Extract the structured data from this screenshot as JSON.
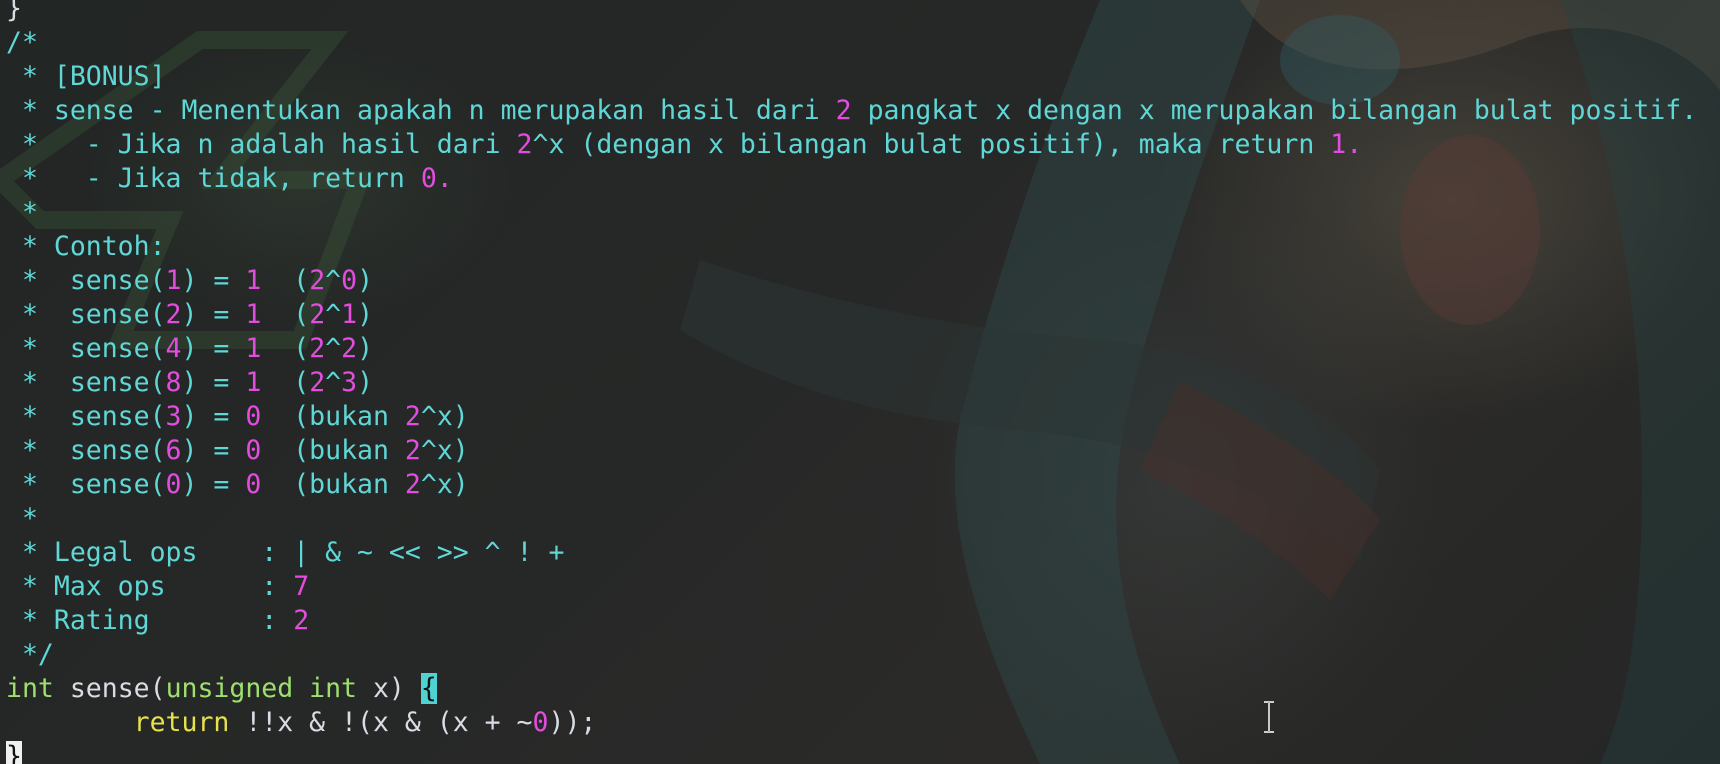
{
  "editor": {
    "lines": [
      [
        {
          "t": "}",
          "c": "plain"
        }
      ],
      [
        {
          "t": "/*",
          "c": "cmt"
        }
      ],
      [
        {
          "t": " * [BONUS]",
          "c": "cmt"
        }
      ],
      [
        {
          "t": " * sense - Menentukan apakah n merupakan hasil dari ",
          "c": "cmt"
        },
        {
          "t": "2",
          "c": "num"
        },
        {
          "t": " pangkat x dengan x merupakan bilangan bulat positif.",
          "c": "cmt"
        }
      ],
      [
        {
          "t": " *   - Jika n adalah hasil dari ",
          "c": "cmt"
        },
        {
          "t": "2",
          "c": "num"
        },
        {
          "t": "^x (dengan x bilangan bulat positif), maka return ",
          "c": "cmt"
        },
        {
          "t": "1.",
          "c": "num"
        }
      ],
      [
        {
          "t": " *   - Jika tidak, return ",
          "c": "cmt"
        },
        {
          "t": "0.",
          "c": "num"
        }
      ],
      [
        {
          "t": " *",
          "c": "cmt"
        }
      ],
      [
        {
          "t": " * Contoh:",
          "c": "cmt"
        }
      ],
      [
        {
          "t": " *  sense(",
          "c": "cmt"
        },
        {
          "t": "1",
          "c": "num"
        },
        {
          "t": ") = ",
          "c": "cmt"
        },
        {
          "t": "1",
          "c": "num"
        },
        {
          "t": "  (",
          "c": "cmt"
        },
        {
          "t": "2",
          "c": "num"
        },
        {
          "t": "^",
          "c": "cmt"
        },
        {
          "t": "0",
          "c": "num"
        },
        {
          "t": ")",
          "c": "cmt"
        }
      ],
      [
        {
          "t": " *  sense(",
          "c": "cmt"
        },
        {
          "t": "2",
          "c": "num"
        },
        {
          "t": ") = ",
          "c": "cmt"
        },
        {
          "t": "1",
          "c": "num"
        },
        {
          "t": "  (",
          "c": "cmt"
        },
        {
          "t": "2",
          "c": "num"
        },
        {
          "t": "^",
          "c": "cmt"
        },
        {
          "t": "1",
          "c": "num"
        },
        {
          "t": ")",
          "c": "cmt"
        }
      ],
      [
        {
          "t": " *  sense(",
          "c": "cmt"
        },
        {
          "t": "4",
          "c": "num"
        },
        {
          "t": ") = ",
          "c": "cmt"
        },
        {
          "t": "1",
          "c": "num"
        },
        {
          "t": "  (",
          "c": "cmt"
        },
        {
          "t": "2",
          "c": "num"
        },
        {
          "t": "^",
          "c": "cmt"
        },
        {
          "t": "2",
          "c": "num"
        },
        {
          "t": ")",
          "c": "cmt"
        }
      ],
      [
        {
          "t": " *  sense(",
          "c": "cmt"
        },
        {
          "t": "8",
          "c": "num"
        },
        {
          "t": ") = ",
          "c": "cmt"
        },
        {
          "t": "1",
          "c": "num"
        },
        {
          "t": "  (",
          "c": "cmt"
        },
        {
          "t": "2",
          "c": "num"
        },
        {
          "t": "^",
          "c": "cmt"
        },
        {
          "t": "3",
          "c": "num"
        },
        {
          "t": ")",
          "c": "cmt"
        }
      ],
      [
        {
          "t": " *  sense(",
          "c": "cmt"
        },
        {
          "t": "3",
          "c": "num"
        },
        {
          "t": ") = ",
          "c": "cmt"
        },
        {
          "t": "0",
          "c": "num"
        },
        {
          "t": "  (bukan ",
          "c": "cmt"
        },
        {
          "t": "2",
          "c": "num"
        },
        {
          "t": "^x)",
          "c": "cmt"
        }
      ],
      [
        {
          "t": " *  sense(",
          "c": "cmt"
        },
        {
          "t": "6",
          "c": "num"
        },
        {
          "t": ") = ",
          "c": "cmt"
        },
        {
          "t": "0",
          "c": "num"
        },
        {
          "t": "  (bukan ",
          "c": "cmt"
        },
        {
          "t": "2",
          "c": "num"
        },
        {
          "t": "^x)",
          "c": "cmt"
        }
      ],
      [
        {
          "t": " *  sense(",
          "c": "cmt"
        },
        {
          "t": "0",
          "c": "num"
        },
        {
          "t": ") = ",
          "c": "cmt"
        },
        {
          "t": "0",
          "c": "num"
        },
        {
          "t": "  (bukan ",
          "c": "cmt"
        },
        {
          "t": "2",
          "c": "num"
        },
        {
          "t": "^x)",
          "c": "cmt"
        }
      ],
      [
        {
          "t": " *",
          "c": "cmt"
        }
      ],
      [
        {
          "t": " * Legal ops    : | & ~ << >> ^ ! +",
          "c": "cmt"
        }
      ],
      [
        {
          "t": " * Max ops      : ",
          "c": "cmt"
        },
        {
          "t": "7",
          "c": "num"
        }
      ],
      [
        {
          "t": " * Rating       : ",
          "c": "cmt"
        },
        {
          "t": "2",
          "c": "num"
        }
      ],
      [
        {
          "t": " */",
          "c": "cmt"
        }
      ],
      [
        {
          "t": "int",
          "c": "tyg"
        },
        {
          "t": " sense(",
          "c": "plain"
        },
        {
          "t": "unsigned int",
          "c": "tyg"
        },
        {
          "t": " x) ",
          "c": "plain"
        },
        {
          "t": "{",
          "c": "brace-hl"
        }
      ],
      [
        {
          "t": "        ",
          "c": "plain"
        },
        {
          "t": "return",
          "c": "kw"
        },
        {
          "t": " !!x & !(x & (x + ~",
          "c": "plain"
        },
        {
          "t": "0",
          "c": "num"
        },
        {
          "t": "));",
          "c": "plain"
        }
      ],
      [
        {
          "t": "}",
          "c": "cursor-block"
        }
      ]
    ]
  },
  "colors": {
    "comment": "#5fd7d7",
    "number": "#e24de0",
    "keyword": "#e7e24a",
    "type": "#9ee06e",
    "text": "#d9dde3",
    "brace_highlight": "#4fd2d2"
  },
  "icons": {
    "text_cursor": "i-beam-cursor-icon"
  }
}
